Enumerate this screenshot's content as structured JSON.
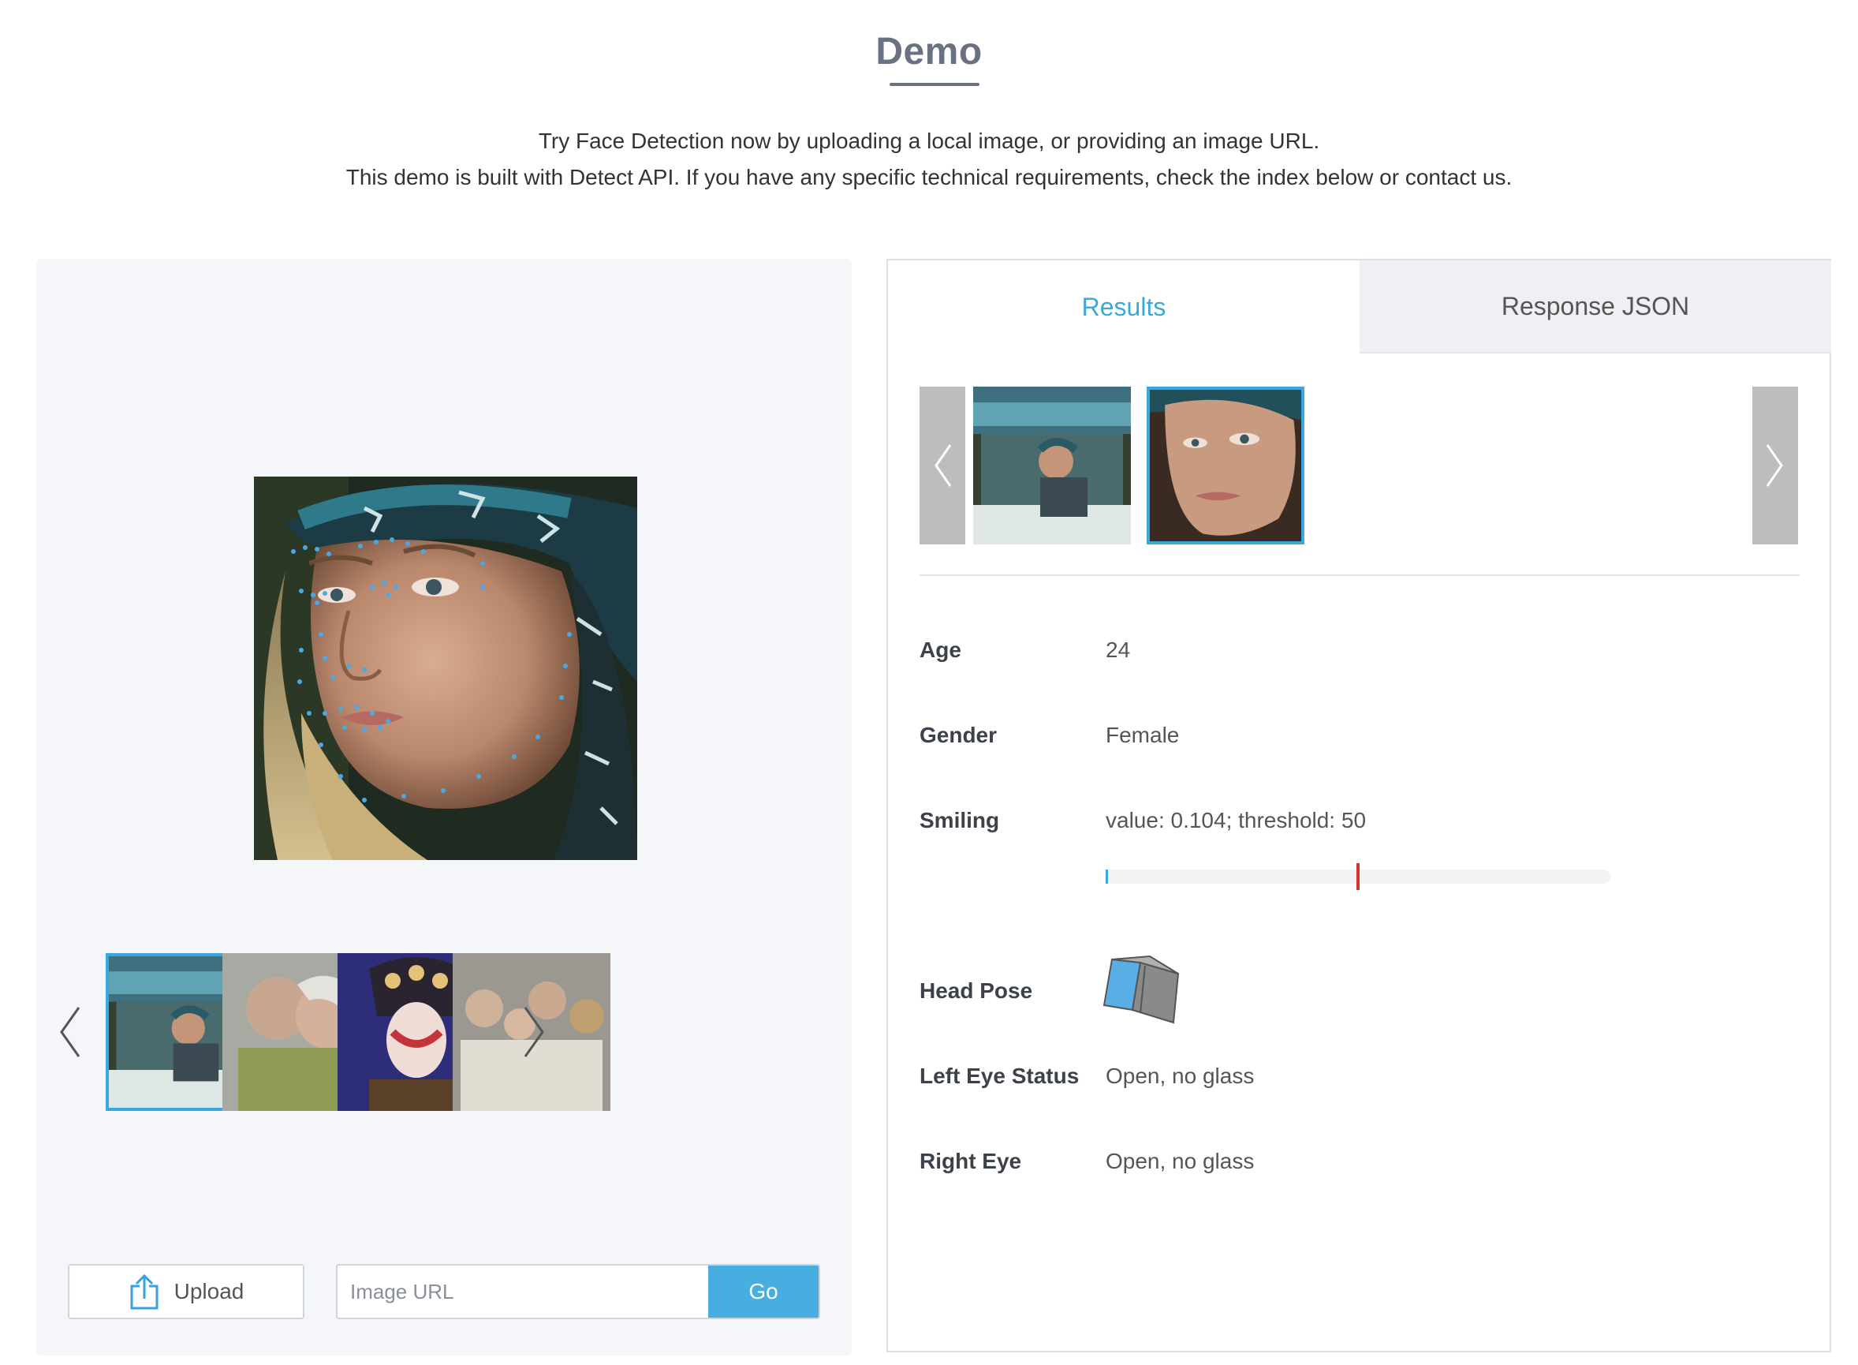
{
  "header": {
    "title": "Demo",
    "intro_line1": "Try Face Detection now by uploading a local image, or providing an image URL.",
    "intro_line2": "This demo is built with Detect API. If you have any specific technical requirements, check the index below or contact us."
  },
  "left_panel": {
    "sample_images": [
      {
        "name": "woman-in-truck",
        "selected": true
      },
      {
        "name": "elderly-couple",
        "selected": false
      },
      {
        "name": "opera-performer",
        "selected": false
      },
      {
        "name": "family-with-dog",
        "selected": false
      }
    ],
    "prev_icon": "chevron-left-icon",
    "next_icon": "chevron-right-icon",
    "upload_label": "Upload",
    "upload_icon": "upload-icon",
    "url_placeholder": "Image URL",
    "url_value": "",
    "go_label": "Go"
  },
  "right_panel": {
    "tabs": [
      {
        "label": "Results",
        "active": true
      },
      {
        "label": "Response JSON",
        "active": false
      }
    ],
    "faces": [
      {
        "name": "full-image",
        "selected": false
      },
      {
        "name": "face-crop",
        "selected": true
      }
    ],
    "attributes": {
      "age_label": "Age",
      "age_value": "24",
      "gender_label": "Gender",
      "gender_value": "Female",
      "smiling_label": "Smiling",
      "smiling_value": "value: 0.104; threshold: 50",
      "smiling_score": 0.104,
      "smiling_threshold": 50,
      "head_pose_label": "Head Pose",
      "head_pose_icon": "head-pose-cube-icon",
      "left_eye_label": "Left Eye Status",
      "left_eye_value": "Open, no glass",
      "right_eye_label": "Right Eye",
      "right_eye_value": "Open, no glass"
    }
  },
  "colors": {
    "accent": "#48aee0",
    "threshold_marker": "#d9342b",
    "title": "#6a7182",
    "panel_bg": "#f4f6fa"
  }
}
